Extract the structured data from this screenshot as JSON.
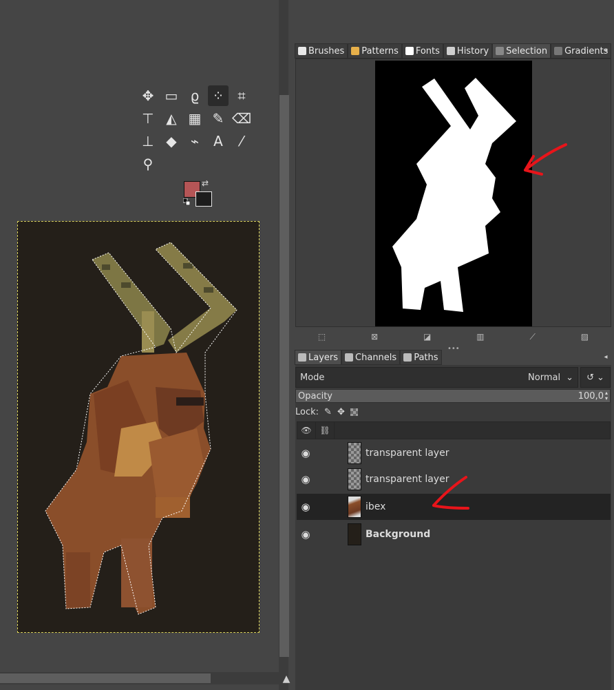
{
  "toolbox": {
    "tools": [
      {
        "name": "move-tool-icon",
        "glyph": "✥"
      },
      {
        "name": "rect-select-tool-icon",
        "glyph": "▭"
      },
      {
        "name": "free-select-tool-icon",
        "glyph": "ϱ"
      },
      {
        "name": "fuzzy-select-tool-icon",
        "glyph": "⁘"
      },
      {
        "name": "crop-tool-icon",
        "glyph": "⌗"
      },
      {
        "name": "unified-transform-tool-icon",
        "glyph": "⊤"
      },
      {
        "name": "warp-transform-tool-icon",
        "glyph": "◭"
      },
      {
        "name": "gradient-tool-icon",
        "glyph": "▦"
      },
      {
        "name": "paintbrush-tool-icon",
        "glyph": "✎"
      },
      {
        "name": "eraser-tool-icon",
        "glyph": "⌫"
      },
      {
        "name": "clone-tool-icon",
        "glyph": "⊥"
      },
      {
        "name": "smudge-tool-icon",
        "glyph": "◆"
      },
      {
        "name": "paths-tool-icon",
        "glyph": "⌁"
      },
      {
        "name": "text-tool-icon",
        "glyph": "A"
      },
      {
        "name": "color-picker-tool-icon",
        "glyph": "⁄"
      },
      {
        "name": "zoom-tool-icon",
        "glyph": "⚲"
      }
    ],
    "active_tool": "fuzzy-select-tool-icon",
    "fg_color": "#b55556",
    "bg_color": "#1d1d1d"
  },
  "top_dock": {
    "tabs": [
      {
        "label": "Brushes",
        "icon": "brushes-icon",
        "color": "#e8e8e8"
      },
      {
        "label": "Patterns",
        "icon": "patterns-icon",
        "color": "#e7b04a"
      },
      {
        "label": "Fonts",
        "icon": "fonts-icon",
        "color": "#ffffff"
      },
      {
        "label": "History",
        "icon": "history-icon",
        "color": "#cfcfcf"
      },
      {
        "label": "Selection",
        "icon": "selection-icon",
        "color": "#888888"
      },
      {
        "label": "Gradients",
        "icon": "gradients-icon",
        "color": "#777777"
      }
    ],
    "selected_tab": "Selection"
  },
  "bottom_dock": {
    "tabs": [
      {
        "label": "Layers",
        "icon": "layers-icon"
      },
      {
        "label": "Channels",
        "icon": "channels-icon"
      },
      {
        "label": "Paths",
        "icon": "paths-icon"
      }
    ],
    "mode_label": "Mode",
    "mode_value": "Normal",
    "opacity_label": "Opacity",
    "opacity_value": "100,0",
    "lock_label": "Lock:",
    "layers": [
      {
        "name": "transparent layer",
        "thumb": "checker",
        "bold": false,
        "selected": false
      },
      {
        "name": "transparent layer",
        "thumb": "checker",
        "bold": false,
        "selected": false
      },
      {
        "name": "ibex",
        "thumb": "ibex",
        "bold": false,
        "selected": true
      },
      {
        "name": "Background",
        "thumb": "dark",
        "bold": true,
        "selected": false
      }
    ]
  },
  "annotations": {
    "arrow_color": "#e8141a"
  },
  "colors": {
    "canvas_bg": "#241f19",
    "selection_boundary": "#d8d05a",
    "ibex_brown": "#8a4e2a",
    "horn": "#7f7845"
  }
}
